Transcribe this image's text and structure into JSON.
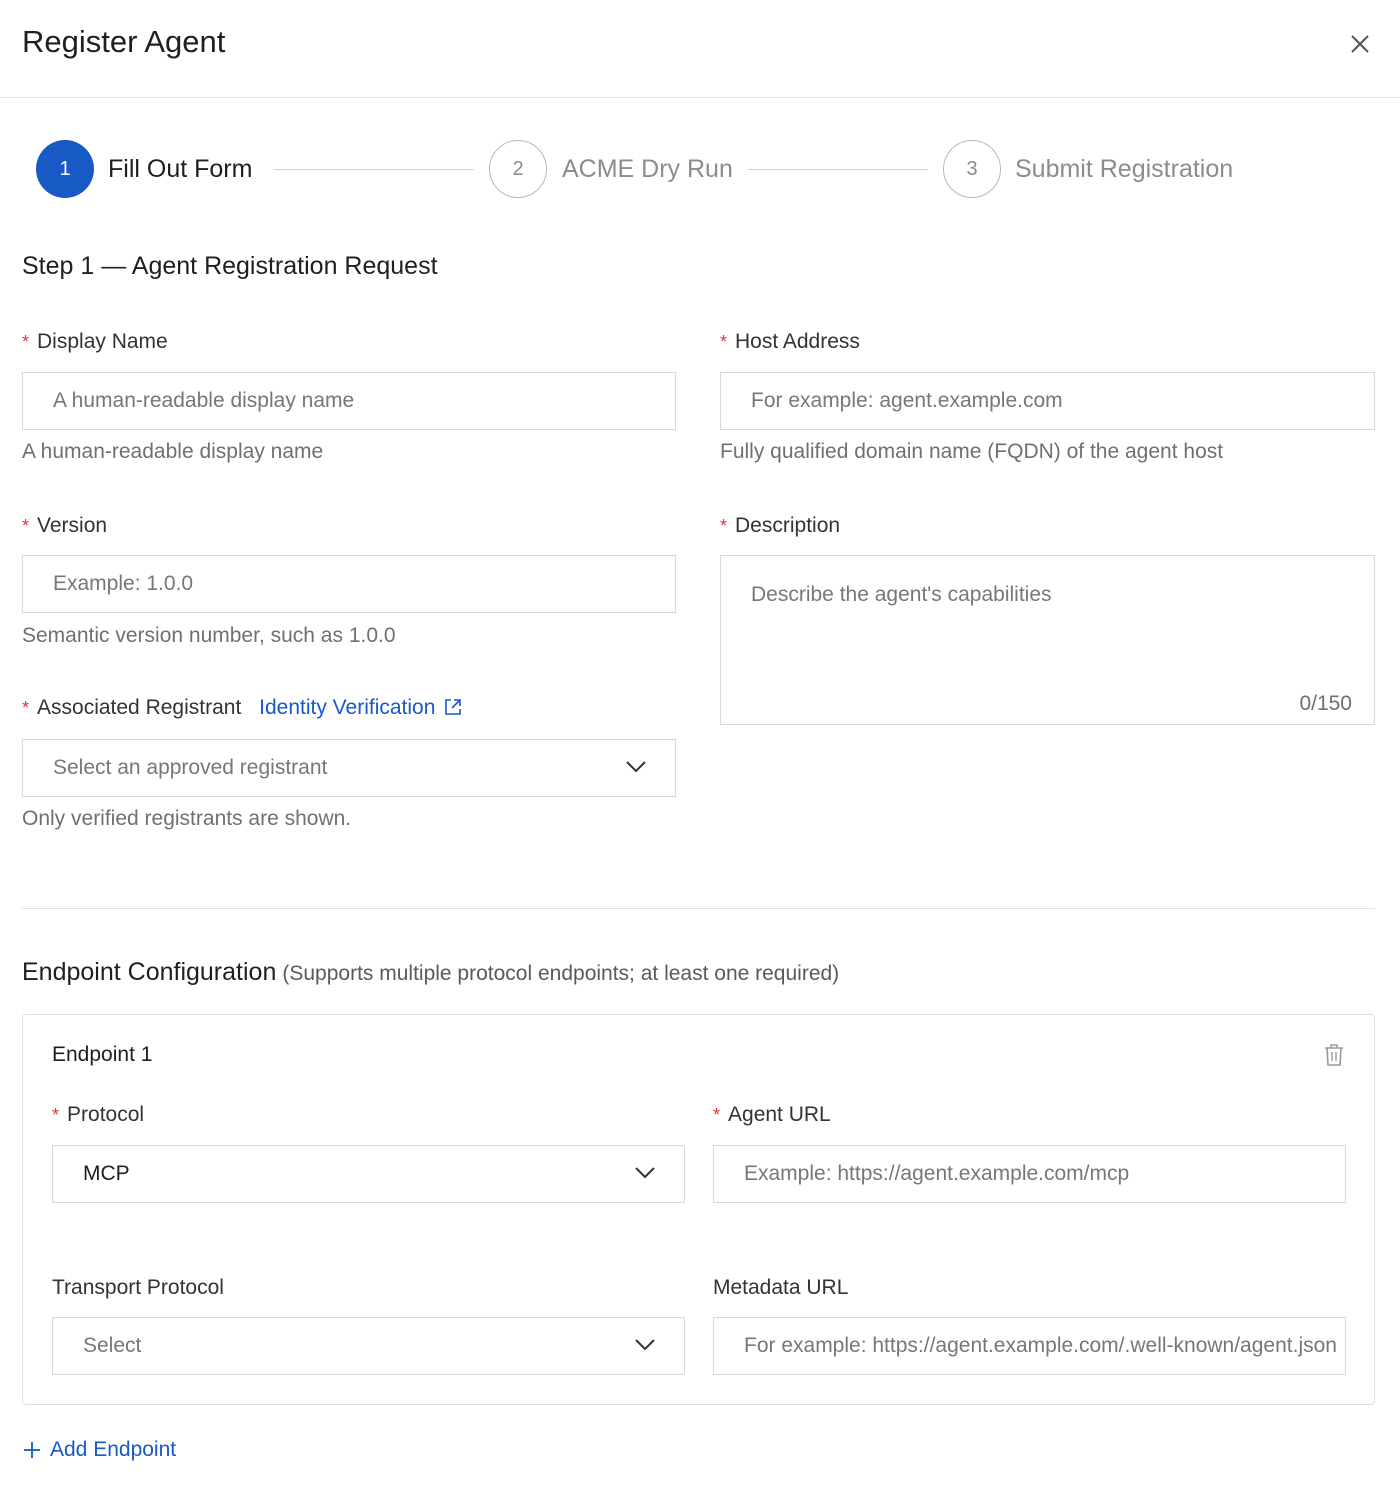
{
  "dialog": {
    "title": "Register Agent"
  },
  "steps": [
    {
      "number": "1",
      "label": "Fill Out Form",
      "state": "active"
    },
    {
      "number": "2",
      "label": "ACME Dry Run",
      "state": "pending"
    },
    {
      "number": "3",
      "label": "Submit Registration",
      "state": "pending"
    }
  ],
  "form": {
    "section_title": "Step 1 — Agent Registration Request",
    "required_mark": "*",
    "display_name": {
      "label": "Display Name",
      "placeholder": "A human-readable display name",
      "help": "A human-readable display name"
    },
    "host_address": {
      "label": "Host Address",
      "placeholder": "For example: agent.example.com",
      "help": "Fully qualified domain name (FQDN) of the agent host"
    },
    "version": {
      "label": "Version",
      "placeholder": "Example: 1.0.0",
      "help": "Semantic version number, such as 1.0.0"
    },
    "description": {
      "label": "Description",
      "placeholder": "Describe the agent's capabilities",
      "counter": "0/150"
    },
    "registrant": {
      "label": "Associated Registrant",
      "link": "Identity Verification",
      "placeholder": "Select an approved registrant",
      "help": "Only verified registrants are shown."
    }
  },
  "endpoints_section": {
    "title": "Endpoint Configuration",
    "subtitle": "(Supports multiple protocol endpoints; at least one required)",
    "endpoints": [
      {
        "title": "Endpoint 1",
        "protocol_label": "Protocol",
        "protocol_value": "MCP",
        "agent_url_label": "Agent URL",
        "agent_url_placeholder": "Example: https://agent.example.com/mcp",
        "transport_label": "Transport Protocol",
        "transport_placeholder": "Select",
        "metadata_label": "Metadata URL",
        "metadata_placeholder": "For example: https://agent.example.com/.well-known/agent.json"
      }
    ],
    "add_label": "Add Endpoint"
  },
  "colors": {
    "accent": "#1759c5",
    "required": "#d9363e",
    "border": "#d9d9d9"
  },
  "icons": {
    "close": "close-icon",
    "chevron": "chevron-down-icon",
    "external": "external-link-icon",
    "trash": "trash-icon",
    "plus": "plus-icon"
  }
}
